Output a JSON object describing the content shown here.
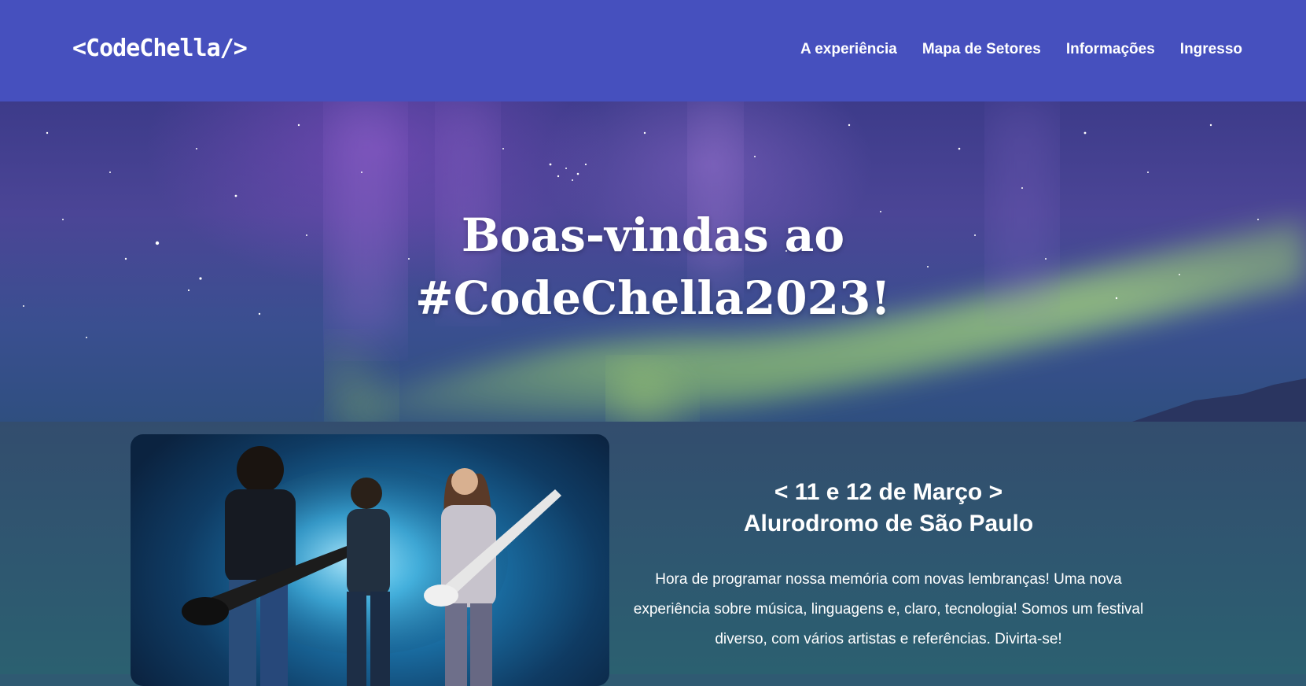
{
  "header": {
    "logo": "<CodeChella/>",
    "nav": [
      "A experiência",
      "Mapa de Setores",
      "Informações",
      "Ingresso"
    ]
  },
  "hero": {
    "title_line1": "Boas-vindas ao",
    "title_line2": "#CodeChella2023!"
  },
  "event": {
    "date": "< 11 e 12 de Março >",
    "place": "Alurodromo de São Paulo",
    "description": "Hora de programar nossa memória com novas lembranças! Uma nova experiência sobre música, linguagens e, claro, tecnologia! Somos um festival diverso, com vários artistas e referências. Divirta-se!"
  },
  "colors": {
    "header_bg": "#4650be",
    "content_bg": "#2f5a72",
    "text": "#ffffff"
  },
  "icons": {
    "hero_image": "aurora-night-sky",
    "band_image": "band-on-stage-photo"
  }
}
